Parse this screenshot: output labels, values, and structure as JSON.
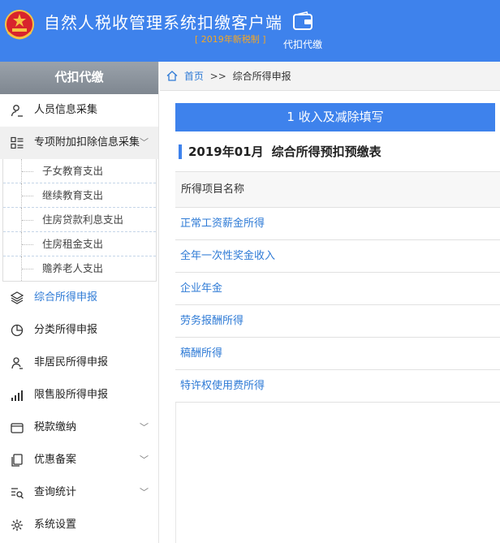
{
  "header": {
    "title": "自然人税收管理系统扣缴客户端",
    "subtitle": "[ 2019年新税制 ]",
    "emblem_icon": "national-emblem-icon",
    "action": {
      "label": "代扣代缴",
      "icon": "wallet-icon"
    },
    "bg_color": "#3e82ec",
    "subtitle_color": "#f5a623"
  },
  "sidebar": {
    "title": "代扣代缴",
    "items": [
      {
        "label": "人员信息采集",
        "icon": "person-edit-icon"
      },
      {
        "label": "专项附加扣除信息采集",
        "icon": "list-icon",
        "expanded": true,
        "children": [
          "子女教育支出",
          "继续教育支出",
          "住房贷款利息支出",
          "住房租金支出",
          "赡养老人支出"
        ]
      },
      {
        "label": "综合所得申报",
        "icon": "layers-icon",
        "active": true
      },
      {
        "label": "分类所得申报",
        "icon": "pie-chart-icon"
      },
      {
        "label": "非居民所得申报",
        "icon": "user-icon"
      },
      {
        "label": "限售股所得申报",
        "icon": "bar-chart-icon"
      },
      {
        "label": "税款缴纳",
        "icon": "wallet-icon",
        "has_children": true
      },
      {
        "label": "优惠备案",
        "icon": "copy-icon",
        "has_children": true
      },
      {
        "label": "查询统计",
        "icon": "search-list-icon",
        "has_children": true
      },
      {
        "label": "系统设置",
        "icon": "gear-icon"
      }
    ]
  },
  "breadcrumb": {
    "home": "首页",
    "separator": ">>",
    "current": "综合所得申报"
  },
  "main": {
    "step_button": "1 收入及减除填写",
    "section_period": "2019年01月",
    "section_title": "综合所得预扣预缴表",
    "table_header": "所得项目名称",
    "rows": [
      "正常工资薪金所得",
      "全年一次性奖金收入",
      "企业年金",
      "劳务报酬所得",
      "稿酬所得",
      "特许权使用费所得"
    ],
    "accent_color": "#3e82ec",
    "link_color": "#2f7bd6"
  }
}
